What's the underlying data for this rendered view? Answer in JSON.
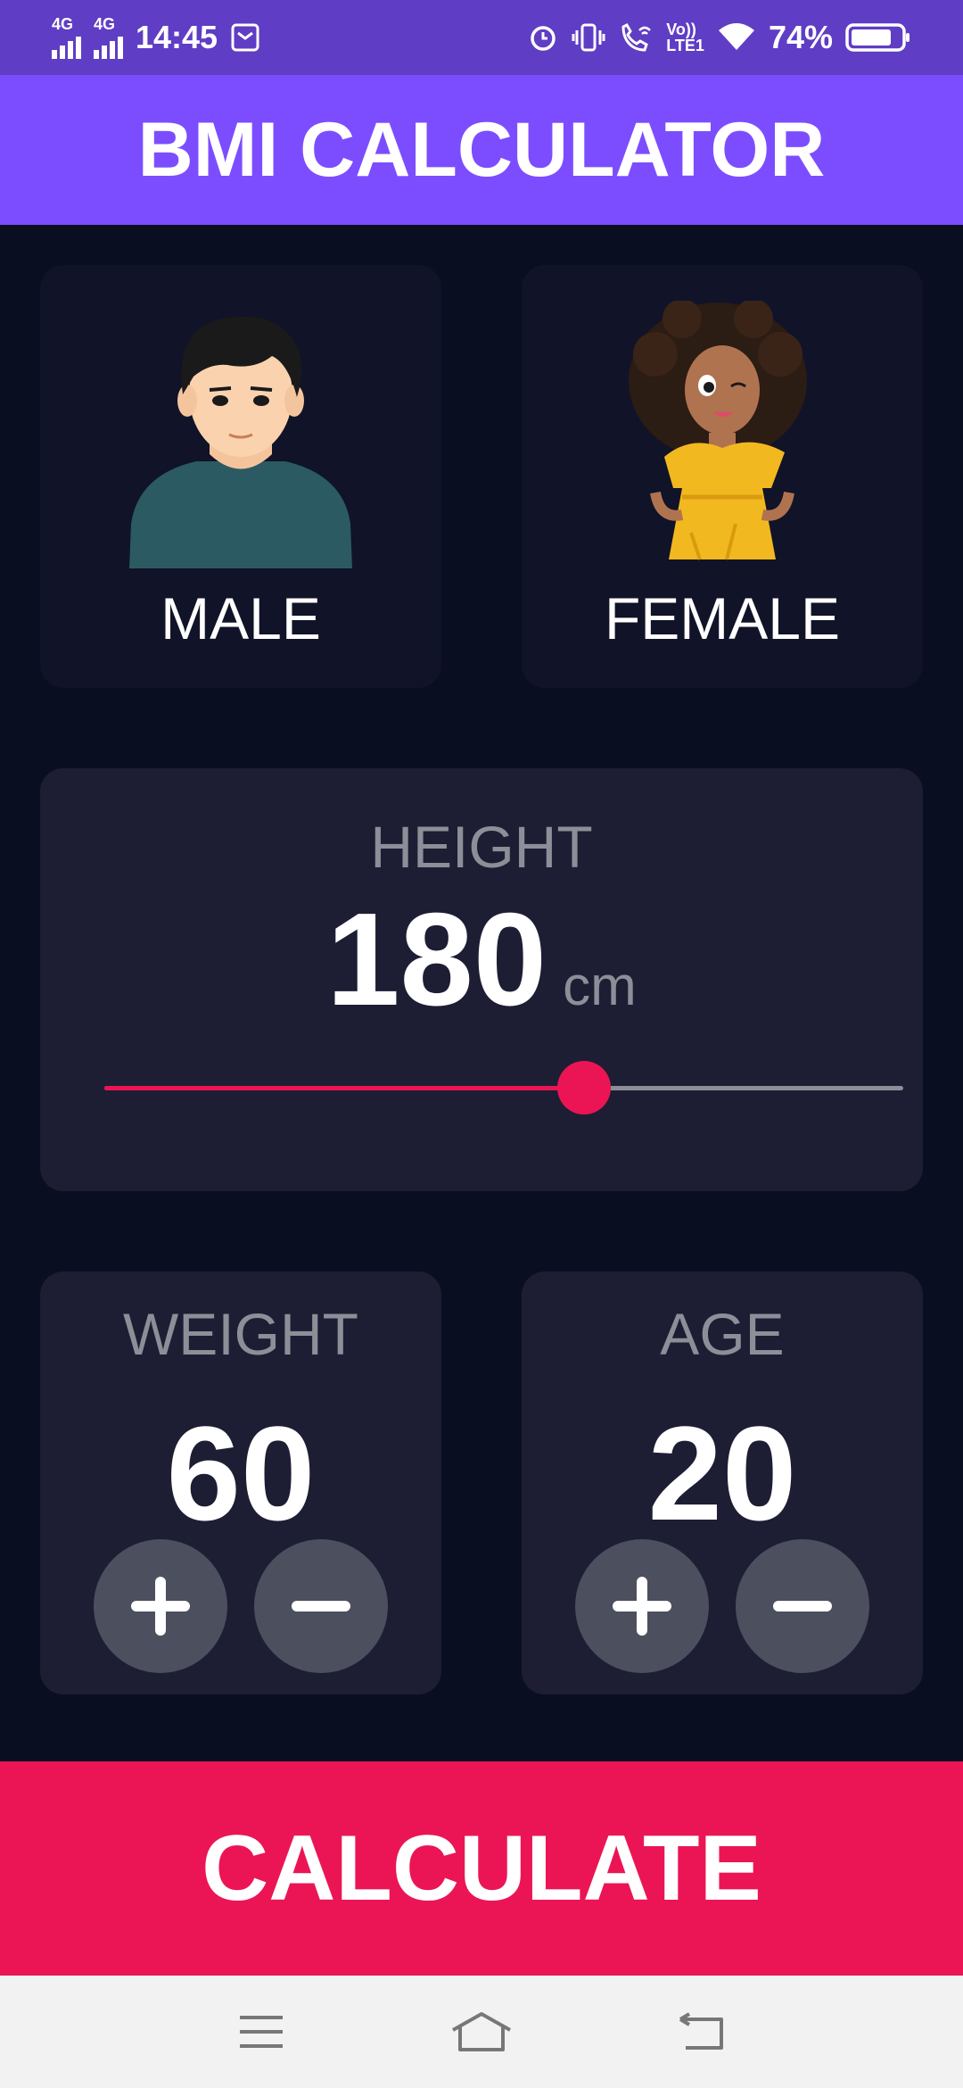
{
  "status_bar": {
    "network_1": "4G",
    "network_2": "4G",
    "time": "14:45",
    "volte": "Vo))",
    "lte": "LTE1",
    "battery": "74%"
  },
  "app_bar": {
    "title": "BMI CALCULATOR"
  },
  "gender": {
    "male_label": "MALE",
    "female_label": "FEMALE"
  },
  "height": {
    "label": "HEIGHT",
    "value": "180",
    "unit": "cm",
    "slider_fraction": 0.6
  },
  "weight": {
    "label": "WEIGHT",
    "value": "60"
  },
  "age": {
    "label": "AGE",
    "value": "20"
  },
  "calculate": {
    "label": "CALCULATE"
  },
  "colors": {
    "accent": "#eb1555",
    "app_bar": "#7c4dff",
    "status_bar": "#5f3dc4",
    "card": "#1d1e33",
    "background": "#0a0e21"
  }
}
